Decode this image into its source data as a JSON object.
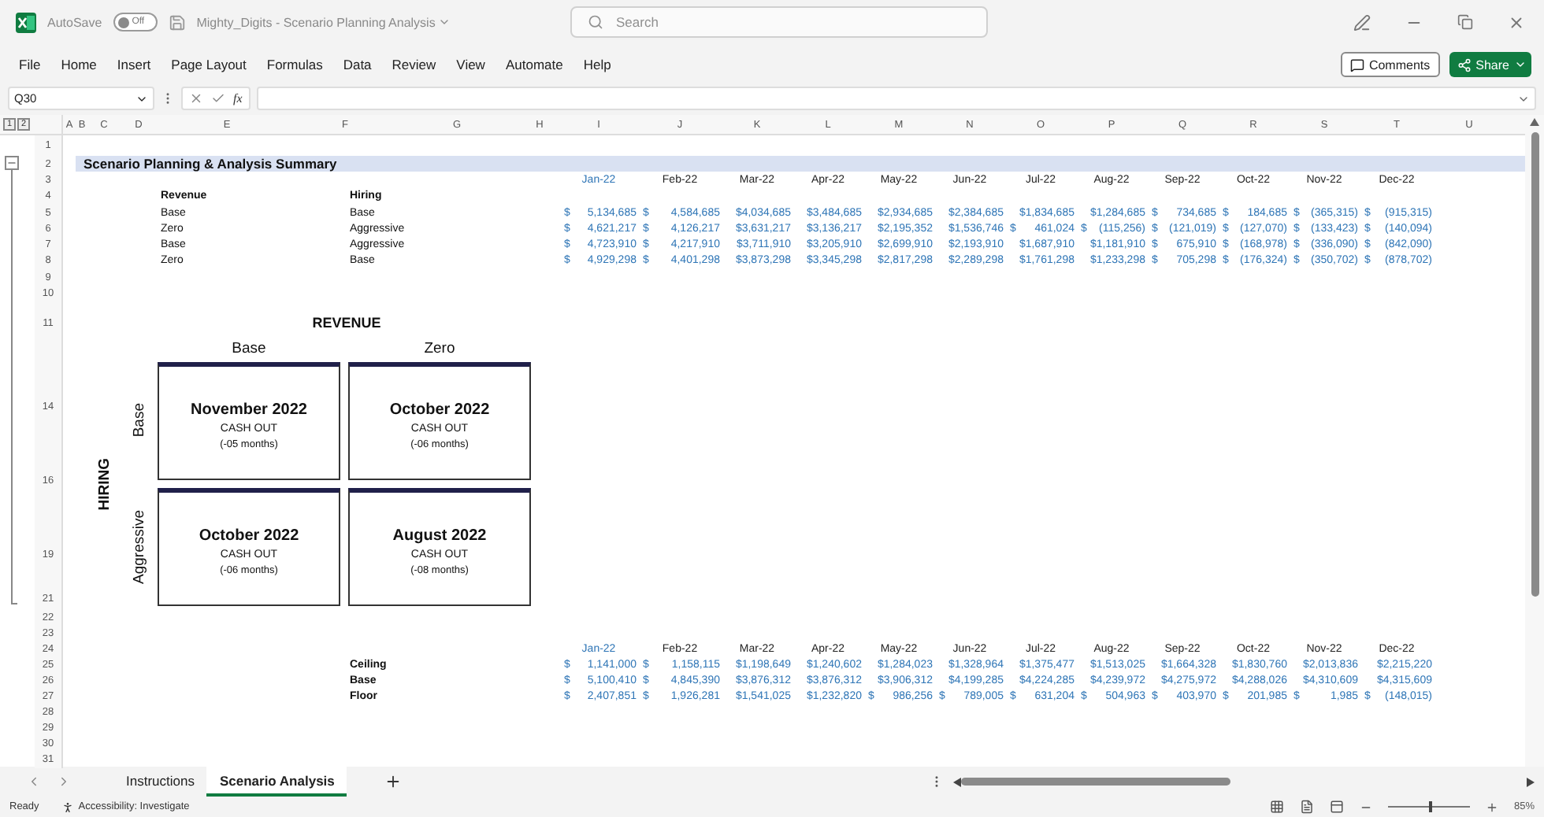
{
  "title_bar": {
    "autosave_label": "AutoSave",
    "autosave_on": false,
    "autosave_state": "Off",
    "document_title": "Mighty_Digits - Scenario Planning Analysis",
    "search_placeholder": "Search"
  },
  "menu": [
    "File",
    "Home",
    "Insert",
    "Page Layout",
    "Formulas",
    "Data",
    "Review",
    "View",
    "Automate",
    "Help"
  ],
  "comments_button": "Comments",
  "share_button": "Share",
  "formula_bar": {
    "name_box": "Q30",
    "function_label": "fx"
  },
  "outline_levels": [
    "1",
    "2"
  ],
  "columns": [
    "A",
    "B",
    "C",
    "D",
    "E",
    "F",
    "G",
    "H",
    "I",
    "J",
    "K",
    "L",
    "M",
    "N",
    "O",
    "P",
    "Q",
    "R",
    "S",
    "T",
    "U"
  ],
  "row_numbers": [
    "1",
    "2",
    "3",
    "4",
    "5",
    "6",
    "7",
    "8",
    "9",
    "10",
    "11",
    "14",
    "16",
    "19",
    "21",
    "22",
    "23",
    "24",
    "25",
    "26",
    "27",
    "28",
    "29",
    "30",
    "31"
  ],
  "summary": {
    "title": "Scenario Planning & Analysis Summary",
    "revenue_header": "Revenue",
    "hiring_header": "Hiring",
    "months": [
      {
        "label": "Jan-22",
        "current": true
      },
      {
        "label": "Feb-22",
        "current": false
      },
      {
        "label": "Mar-22",
        "current": false
      },
      {
        "label": "Apr-22",
        "current": false
      },
      {
        "label": "May-22",
        "current": false
      },
      {
        "label": "Jun-22",
        "current": false
      },
      {
        "label": "Jul-22",
        "current": false
      },
      {
        "label": "Aug-22",
        "current": false
      },
      {
        "label": "Sep-22",
        "current": false
      },
      {
        "label": "Oct-22",
        "current": false
      },
      {
        "label": "Nov-22",
        "current": false
      },
      {
        "label": "Dec-22",
        "current": false
      }
    ],
    "scenarios": [
      {
        "revenue": "Base",
        "hiring": "Base",
        "values": [
          [
            "$",
            "5,134,685"
          ],
          [
            "$",
            "4,584,685"
          ],
          [
            "$4,034,685"
          ],
          [
            "$3,484,685"
          ],
          [
            "$2,934,685"
          ],
          [
            "$2,384,685"
          ],
          [
            "$1,834,685"
          ],
          [
            "$1,284,685"
          ],
          [
            "$",
            "734,685"
          ],
          [
            "$",
            "184,685"
          ],
          [
            "$",
            "(365,315)"
          ],
          [
            "$",
            "(915,315)"
          ]
        ]
      },
      {
        "revenue": "Zero",
        "hiring": "Aggressive",
        "values": [
          [
            "$",
            "4,621,217"
          ],
          [
            "$",
            "4,126,217"
          ],
          [
            "$3,631,217"
          ],
          [
            "$3,136,217"
          ],
          [
            "$2,195,352"
          ],
          [
            "$1,536,746"
          ],
          [
            "$",
            "461,024"
          ],
          [
            "$",
            "(115,256)"
          ],
          [
            "$",
            "(121,019)"
          ],
          [
            "$",
            "(127,070)"
          ],
          [
            "$",
            "(133,423)"
          ],
          [
            "$",
            "(140,094)"
          ]
        ]
      },
      {
        "revenue": "Base",
        "hiring": "Aggressive",
        "values": [
          [
            "$",
            "4,723,910"
          ],
          [
            "$",
            "4,217,910"
          ],
          [
            "$3,711,910"
          ],
          [
            "$3,205,910"
          ],
          [
            "$2,699,910"
          ],
          [
            "$2,193,910"
          ],
          [
            "$1,687,910"
          ],
          [
            "$1,181,910"
          ],
          [
            "$",
            "675,910"
          ],
          [
            "$",
            "(168,978)"
          ],
          [
            "$",
            "(336,090)"
          ],
          [
            "$",
            "(842,090)"
          ]
        ]
      },
      {
        "revenue": "Zero",
        "hiring": "Base",
        "values": [
          [
            "$",
            "4,929,298"
          ],
          [
            "$",
            "4,401,298"
          ],
          [
            "$3,873,298"
          ],
          [
            "$3,345,298"
          ],
          [
            "$2,817,298"
          ],
          [
            "$2,289,298"
          ],
          [
            "$1,761,298"
          ],
          [
            "$1,233,298"
          ],
          [
            "$",
            "705,298"
          ],
          [
            "$",
            "(176,324)"
          ],
          [
            "$",
            "(350,702)"
          ],
          [
            "$",
            "(878,702)"
          ]
        ]
      }
    ]
  },
  "matrix": {
    "title": "REVENUE",
    "row_axis": "HIRING",
    "column_headers": [
      "Base",
      "Zero"
    ],
    "row_headers": [
      "Base",
      "Aggressive"
    ],
    "cells": [
      {
        "date": "November 2022",
        "label": "CASH OUT",
        "note": "(-05 months)"
      },
      {
        "date": "October 2022",
        "label": "CASH OUT",
        "note": "(-06 months)"
      },
      {
        "date": "October 2022",
        "label": "CASH OUT",
        "note": "(-06 months)"
      },
      {
        "date": "August 2022",
        "label": "CASH OUT",
        "note": "(-08 months)"
      }
    ]
  },
  "bands": {
    "months": [
      {
        "label": "Jan-22",
        "current": true
      },
      {
        "label": "Feb-22",
        "current": false
      },
      {
        "label": "Mar-22",
        "current": false
      },
      {
        "label": "Apr-22",
        "current": false
      },
      {
        "label": "May-22",
        "current": false
      },
      {
        "label": "Jun-22",
        "current": false
      },
      {
        "label": "Jul-22",
        "current": false
      },
      {
        "label": "Aug-22",
        "current": false
      },
      {
        "label": "Sep-22",
        "current": false
      },
      {
        "label": "Oct-22",
        "current": false
      },
      {
        "label": "Nov-22",
        "current": false
      },
      {
        "label": "Dec-22",
        "current": false
      }
    ],
    "rows": [
      {
        "label": "Ceiling",
        "values": [
          [
            "$",
            "1,141,000"
          ],
          [
            "$",
            "1,158,115"
          ],
          [
            "$1,198,649"
          ],
          [
            "$1,240,602"
          ],
          [
            "$1,284,023"
          ],
          [
            "$1,328,964"
          ],
          [
            "$1,375,477"
          ],
          [
            "$1,513,025"
          ],
          [
            "$1,664,328"
          ],
          [
            "$1,830,760"
          ],
          [
            "$2,013,836"
          ],
          [
            "$2,215,220"
          ]
        ]
      },
      {
        "label": "Base",
        "values": [
          [
            "$",
            "5,100,410"
          ],
          [
            "$",
            "4,845,390"
          ],
          [
            "$3,876,312"
          ],
          [
            "$3,876,312"
          ],
          [
            "$3,906,312"
          ],
          [
            "$4,199,285"
          ],
          [
            "$4,224,285"
          ],
          [
            "$4,239,972"
          ],
          [
            "$4,275,972"
          ],
          [
            "$4,288,026"
          ],
          [
            "$4,310,609"
          ],
          [
            "$4,315,609"
          ]
        ]
      },
      {
        "label": "Floor",
        "values": [
          [
            "$",
            "2,407,851"
          ],
          [
            "$",
            "1,926,281"
          ],
          [
            "$1,541,025"
          ],
          [
            "$1,232,820"
          ],
          [
            "$",
            "986,256"
          ],
          [
            "$",
            "789,005"
          ],
          [
            "$",
            "631,204"
          ],
          [
            "$",
            "504,963"
          ],
          [
            "$",
            "403,970"
          ],
          [
            "$",
            "201,985"
          ],
          [
            "$",
            "1,985"
          ],
          [
            "$",
            "(148,015)"
          ]
        ]
      }
    ]
  },
  "sheet_tabs": [
    {
      "label": "Instructions",
      "selected": false
    },
    {
      "label": "Scenario Analysis",
      "selected": true
    }
  ],
  "status_bar": {
    "ready": "Ready",
    "accessibility": "Accessibility: Investigate",
    "zoom": {
      "level": 0.5,
      "reading": "85%"
    }
  }
}
